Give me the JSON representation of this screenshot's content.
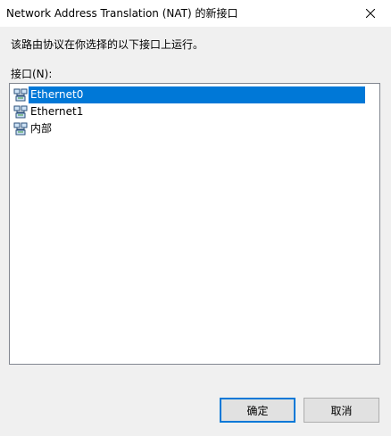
{
  "window": {
    "title": "Network Address Translation (NAT) 的新接口"
  },
  "dialog": {
    "description": "该路由协议在你选择的以下接口上运行。",
    "list_label": "接口(N):",
    "interfaces": [
      {
        "label": "Ethernet0",
        "icon": "network-adapter-icon",
        "selected": true
      },
      {
        "label": "Ethernet1",
        "icon": "network-adapter-icon",
        "selected": false
      },
      {
        "label": "内部",
        "icon": "network-adapter-icon",
        "selected": false
      }
    ],
    "ok_label": "确定",
    "cancel_label": "取消"
  },
  "colors": {
    "selection": "#0078d7",
    "window_bg": "#f0f0f0",
    "list_border": "#828790"
  }
}
